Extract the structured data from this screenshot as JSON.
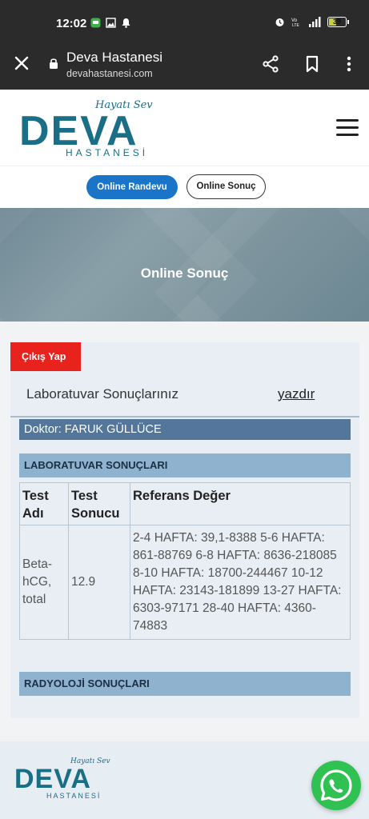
{
  "status_bar": {
    "time": "12:02",
    "battery_level": "39",
    "battery_color": "#c9d23b"
  },
  "browser": {
    "title": "Deva Hastanesi",
    "url": "devahastanesi.com"
  },
  "site": {
    "tagline": "Hayatı Sev",
    "logo_word": "DEVA",
    "logo_sub": "HASTANESİ",
    "brand_color": "#1a6e86"
  },
  "nav": {
    "appointment_label": "Online Randevu",
    "results_label": "Online Sonuç"
  },
  "hero": {
    "title": "Online Sonuç"
  },
  "panel": {
    "logout_label": "Çıkış Yap",
    "title": "Laboratuvar Sonuçlarınız",
    "print_label": "yazdır",
    "doctor": "Doktor: FARUK GÜLLÜCE",
    "lab_heading": "LABORATUVAR SONUÇLARI",
    "radiology_heading": "RADYOLOJİ SONUÇLARI"
  },
  "results_table": {
    "headers": [
      "Test Adı",
      "Test Sonucu",
      "Referans Değer"
    ],
    "rows": [
      {
        "test_name": "Beta-hCG, total",
        "result": "12.9",
        "reference": "2-4 HAFTA: 39,1-8388 5-6 HAFTA: 861-88769 6-8 HAFTA: 8636-218085 8-10 HAFTA: 18700-244467 10-12 HAFTA: 23143-181899 13-27 HAFTA: 6303-97171 28-40 HAFTA: 4360-74883"
      }
    ]
  },
  "colors": {
    "primary_button": "#1a74c7",
    "logout_button": "#e8221d",
    "doctor_bar": "#53769a",
    "section_header": "#8fb2cf",
    "whatsapp": "#2fc152"
  }
}
